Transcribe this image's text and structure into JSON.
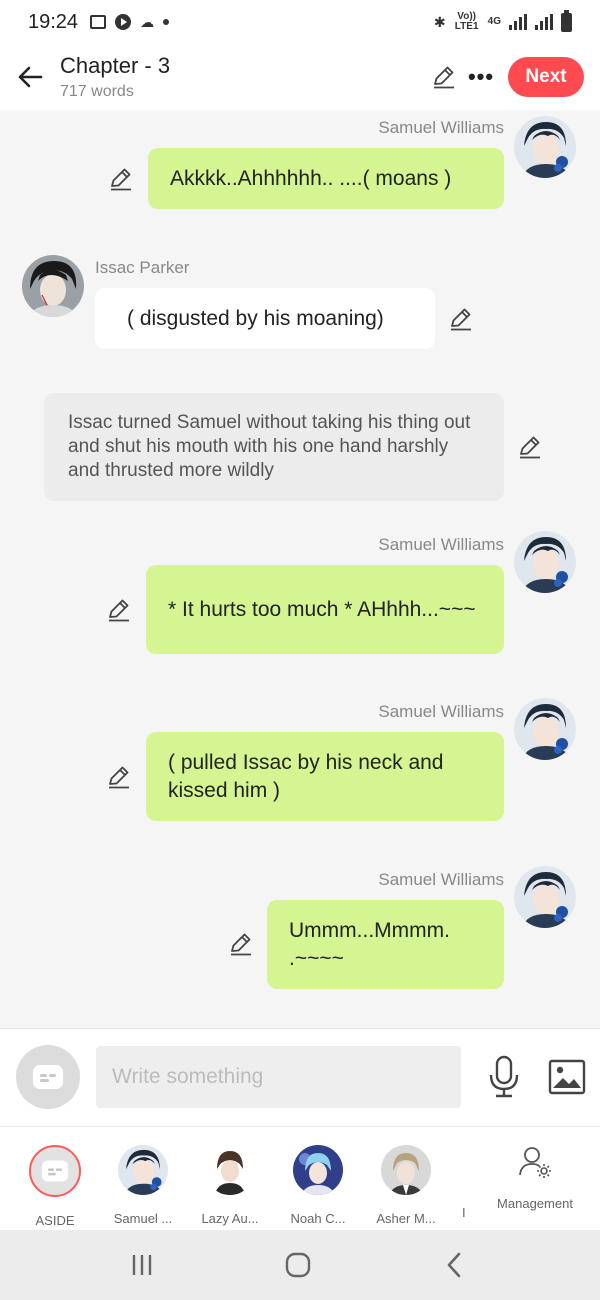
{
  "status_bar": {
    "time": "19:24",
    "volte": "Vo)) LTE1",
    "network": "4G"
  },
  "header": {
    "title": "Chapter - 3",
    "word_count": "717 words",
    "next_label": "Next",
    "next_color": "#ff4a50"
  },
  "messages": [
    {
      "speaker": "Samuel Williams",
      "text": "Akkkk..Ahhhhhh.. ....( moans )"
    },
    {
      "speaker": "Issac Parker",
      "text": "( disgusted by his moaning)"
    },
    {
      "text": "Issac turned Samuel without taking his thing out and shut his mouth with his one hand harshly and thrusted more wildly"
    },
    {
      "speaker": "Samuel Williams",
      "text": "* It hurts too much * AHhhh...~~~"
    },
    {
      "speaker": "Samuel Williams",
      "text": "( pulled Issac by his neck and kissed him )"
    },
    {
      "speaker": "Samuel Williams",
      "text": "Ummm...Mmmm. .~~~~"
    }
  ],
  "composer": {
    "placeholder": "Write something"
  },
  "characters": [
    {
      "label": "ASIDE"
    },
    {
      "label": "Samuel ..."
    },
    {
      "label": "Lazy Au..."
    },
    {
      "label": "Noah C..."
    },
    {
      "label": "Asher M..."
    }
  ],
  "truncated_label": "I",
  "management_label": "Management",
  "colors": {
    "accent": "#ff4a50",
    "bubble_green": "#d5f592",
    "narration_bg": "#ececec"
  }
}
